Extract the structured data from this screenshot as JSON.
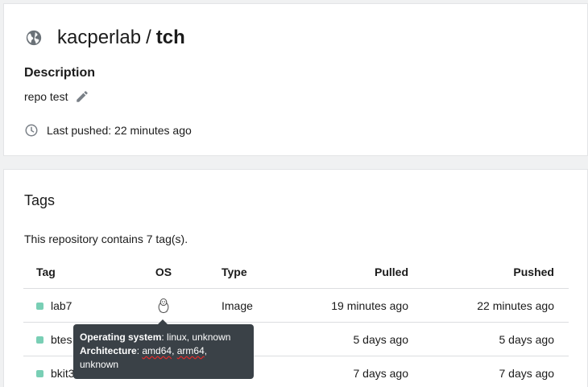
{
  "repo": {
    "namespace": "kacperlab",
    "separator": "/",
    "name": "tch",
    "description_label": "Description",
    "description": "repo test",
    "last_pushed": "Last pushed: 22 minutes ago"
  },
  "tags": {
    "title": "Tags",
    "count_text": "This repository contains 7 tag(s).",
    "columns": {
      "tag": "Tag",
      "os": "OS",
      "type": "Type",
      "pulled": "Pulled",
      "pushed": "Pushed"
    },
    "rows": [
      {
        "tag": "lab7",
        "type": "Image",
        "pulled": "19 minutes ago",
        "pushed": "22 minutes ago",
        "status_color": "#79cfb5"
      },
      {
        "tag": "btes",
        "type": "",
        "pulled": "5 days ago",
        "pushed": "5 days ago",
        "status_color": "#79cfb5"
      },
      {
        "tag": "bkit3",
        "type": "",
        "pulled": "7 days ago",
        "pushed": "7 days ago",
        "status_color": "#79cfb5"
      }
    ]
  },
  "tooltip": {
    "os_label": "Operating system",
    "os_value": ": linux, unknown",
    "arch_label": "Architecture",
    "arch_sep": ": ",
    "arch_1": "amd64",
    "comma": ", ",
    "arch_2": "arm64",
    "arch_3": ", unknown"
  },
  "icons": {
    "repo": "globe-icon",
    "edit": "pencil-icon",
    "time": "clock-icon",
    "os": "linux-tux-icon"
  },
  "colors": {
    "status": "#79cfb5",
    "tooltip_bg": "#3a4147",
    "spell_underline": "#e02b2b"
  }
}
